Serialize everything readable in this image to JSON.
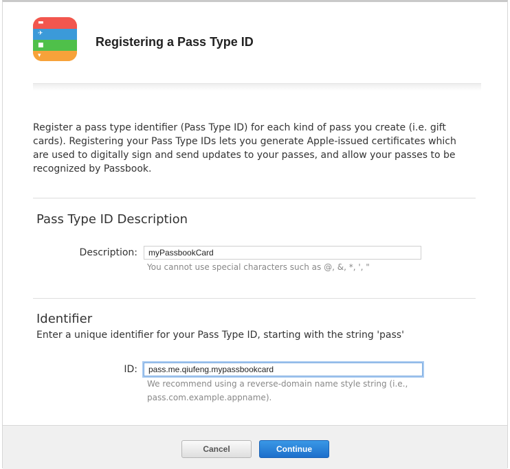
{
  "header": {
    "title": "Registering a Pass Type ID",
    "icon": "passbook-icon"
  },
  "intro_text": "Register a pass type identifier (Pass Type ID) for each kind of pass you create (i.e. gift cards). Registering your Pass Type IDs lets you generate Apple-issued certificates which are used to digitally sign and send updates to your passes, and allow your passes to be recognized by Passbook.",
  "description_section": {
    "title": "Pass Type ID Description",
    "label": "Description:",
    "value": "myPassbookCard",
    "hint": "You cannot use special characters such as @, &, *, ', \""
  },
  "identifier_section": {
    "title": "Identifier",
    "subtitle": "Enter a unique identifier for your Pass Type ID, starting with the string 'pass'",
    "label": "ID:",
    "value": "pass.me.qiufeng.mypassbookcard",
    "hint_line1": "We recommend using a reverse-domain name style string (i.e.,",
    "hint_line2": "pass.com.example.appname)."
  },
  "footer": {
    "cancel_label": "Cancel",
    "continue_label": "Continue"
  },
  "colors": {
    "primary_button": "#1d6fcb",
    "focus_ring": "#a7c9f0"
  }
}
